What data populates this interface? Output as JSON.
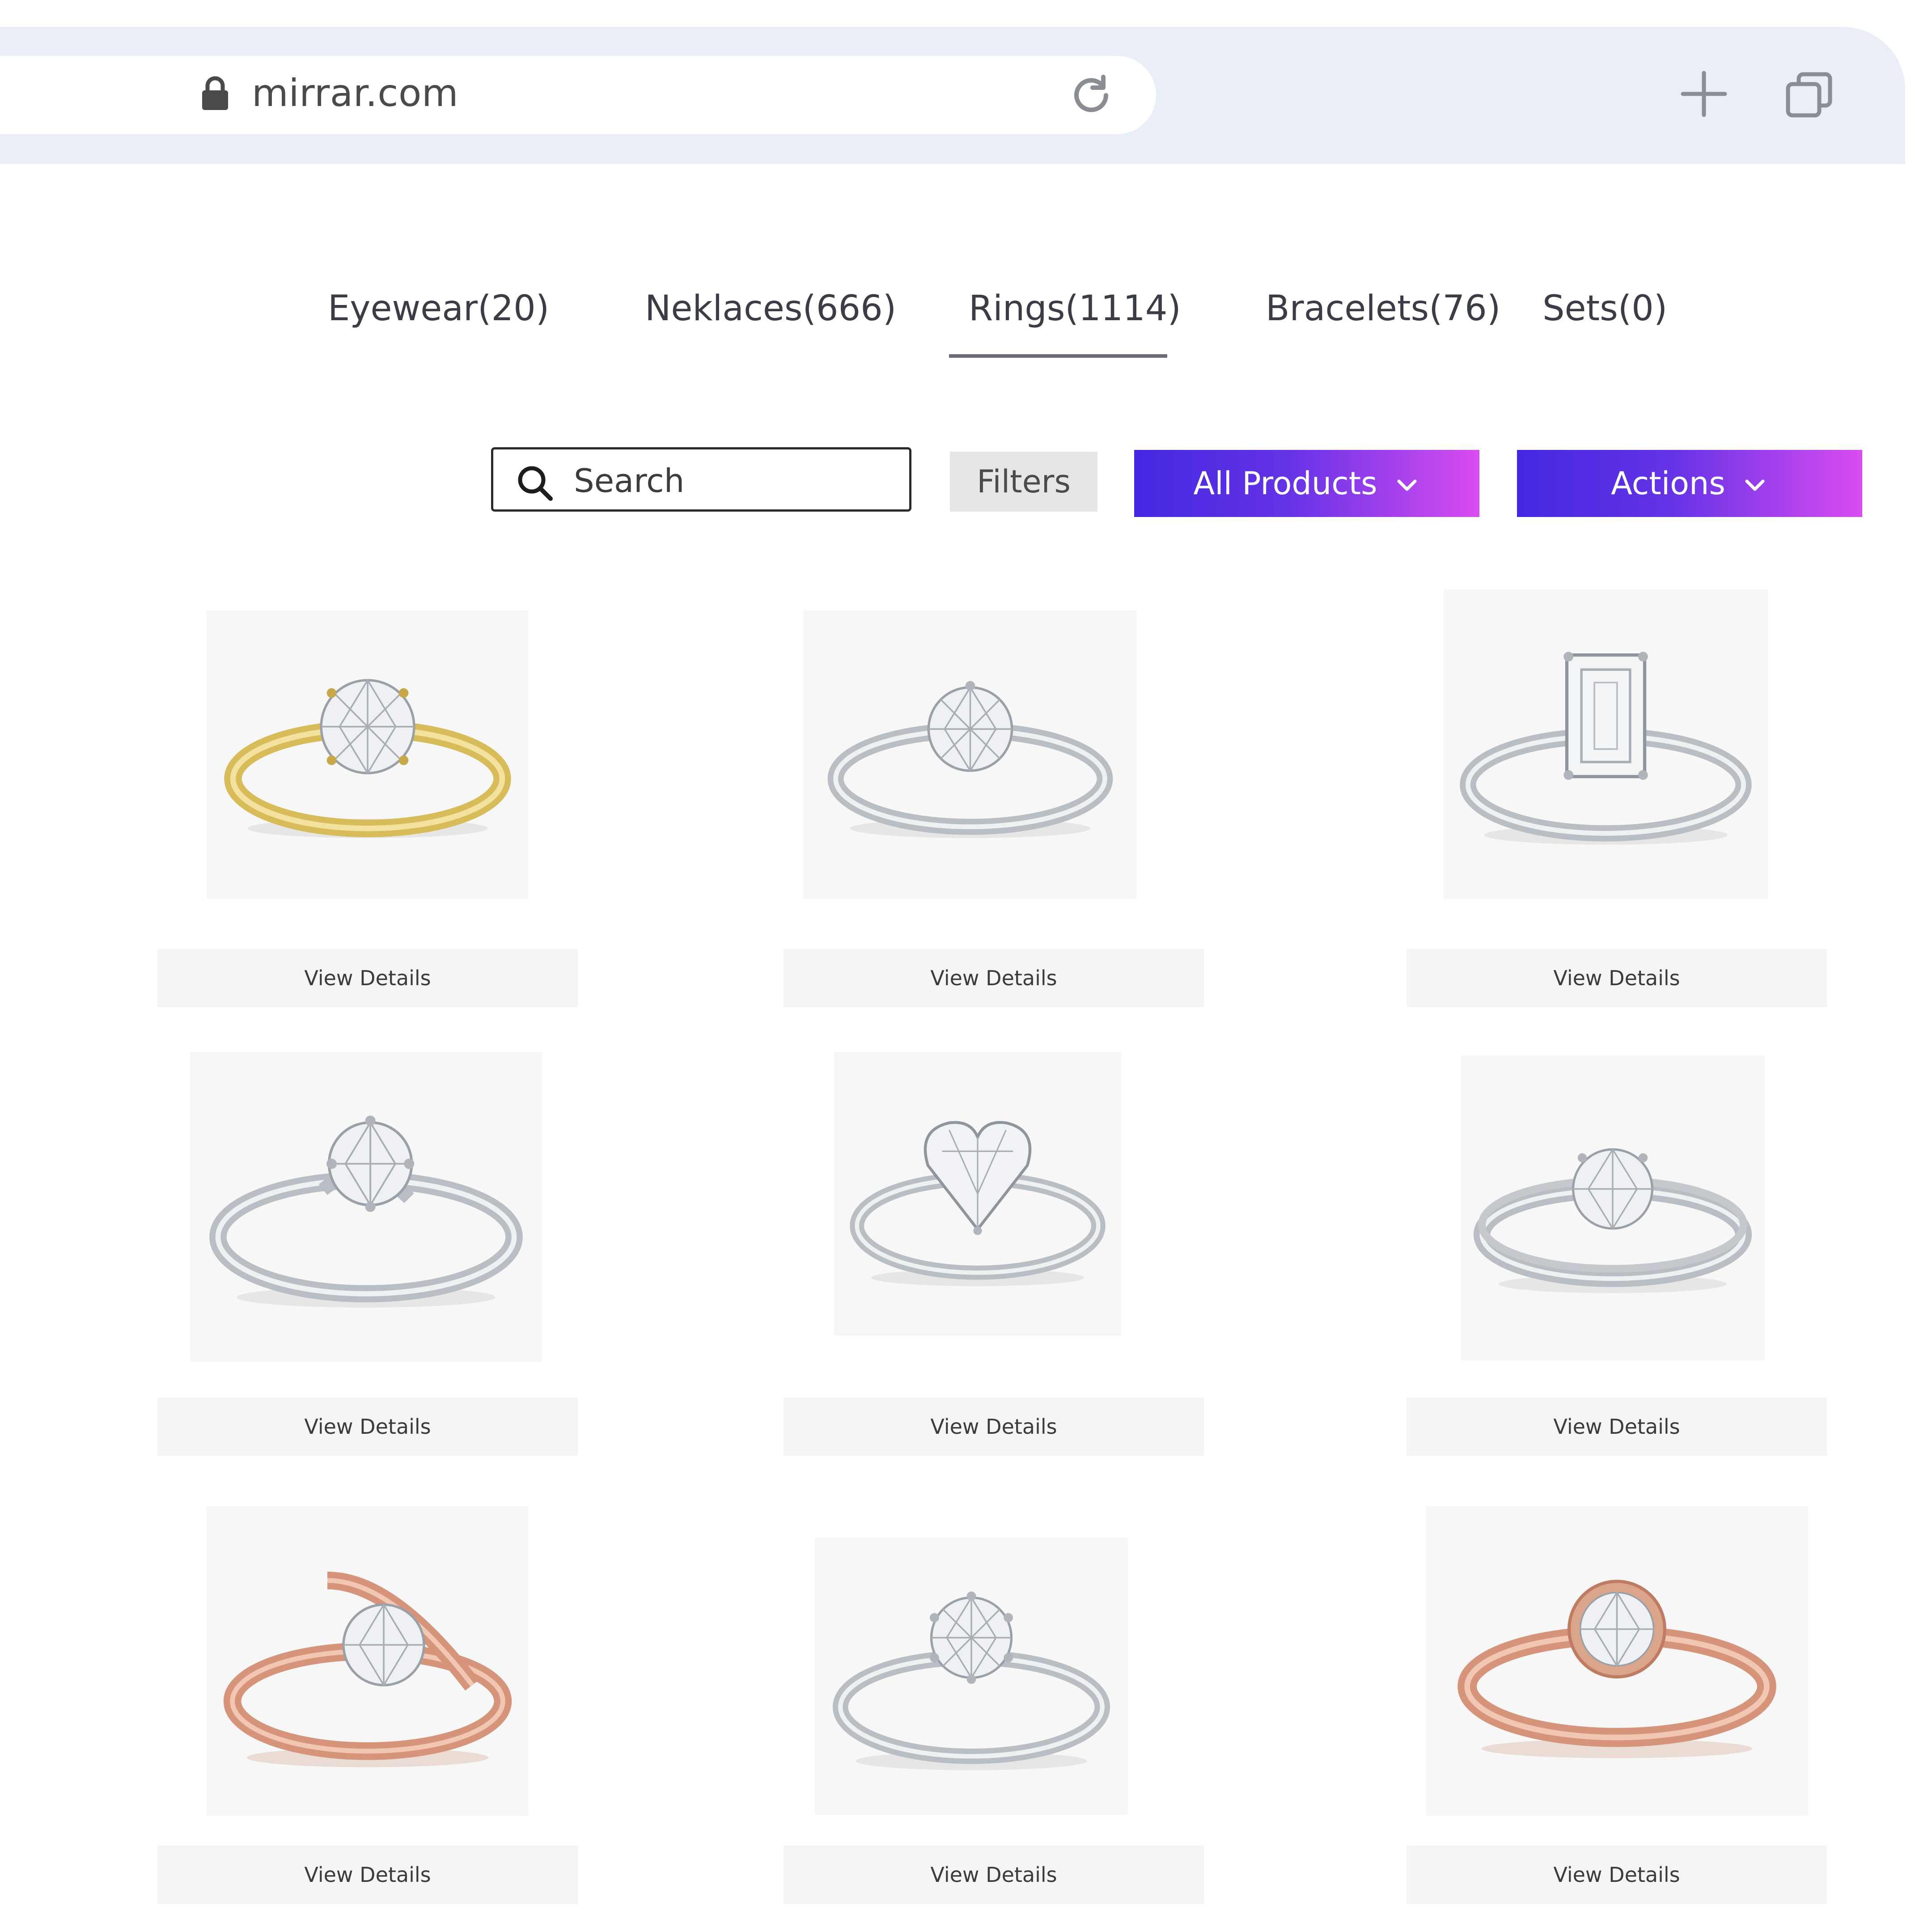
{
  "browser": {
    "url": "mirrar.com",
    "icons": [
      "lock-icon",
      "reload-icon",
      "new-tab-plus-icon",
      "tabs-switcher-icon"
    ]
  },
  "categories": [
    {
      "label": "Eyewear(20)",
      "active": false
    },
    {
      "label": "Neklaces(666)",
      "active": false
    },
    {
      "label": "Rings(1114)",
      "active": true
    },
    {
      "label": "Bracelets(76)",
      "active": false
    },
    {
      "label": "Sets(0)",
      "active": false
    }
  ],
  "toolbar": {
    "search_placeholder": "Search",
    "filters_label": "Filters",
    "all_products_label": "All Products",
    "actions_label": "Actions",
    "accent_gradient": [
      "#4328e0",
      "#d94cf0"
    ]
  },
  "products": [
    {
      "metal": "yellow gold",
      "stone": "round solitaire",
      "button": "View Details"
    },
    {
      "metal": "white gold",
      "stone": "round solitaire",
      "button": "View Details"
    },
    {
      "metal": "white gold",
      "stone": "emerald cut",
      "button": "View Details"
    },
    {
      "metal": "white gold",
      "stone": "round twist",
      "button": "View Details"
    },
    {
      "metal": "white gold",
      "stone": "heart",
      "button": "View Details"
    },
    {
      "metal": "white gold",
      "stone": "round split shank",
      "button": "View Details"
    },
    {
      "metal": "rose gold",
      "stone": "round bypass",
      "button": "View Details"
    },
    {
      "metal": "white gold",
      "stone": "round six prong",
      "button": "View Details"
    },
    {
      "metal": "rose gold",
      "stone": "round bezel",
      "button": "View Details"
    }
  ],
  "colors": {
    "browser_bar": "#eaeef6",
    "yellow_gold": "#e3c96a",
    "white_gold": "#c9ccd0",
    "rose_gold": "#e2a488"
  }
}
